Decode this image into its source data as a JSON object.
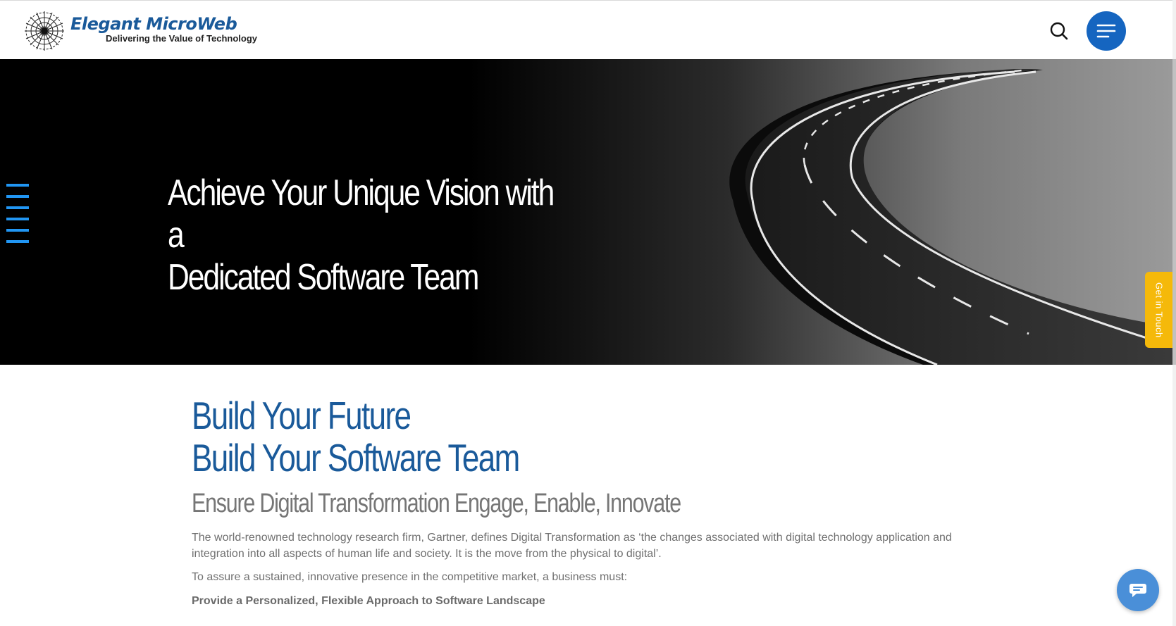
{
  "header": {
    "brand_name": "Elegant MicroWeb",
    "tagline": "Delivering the Value of Technology",
    "search_icon": "search-icon",
    "menu_icon": "hamburger-icon",
    "accent_color": "#1565c0"
  },
  "hero": {
    "title_line1": "Achieve Your Unique Vision with a",
    "title_line2": "Dedicated Software Team",
    "get_in_touch": "Get in Touch",
    "side_menu_icon": "side-menu-icon",
    "tab_color": "#f5b90a"
  },
  "main": {
    "headline_line1": "Build Your Future",
    "headline_line2": "Build Your Software Team",
    "subheading": "Ensure Digital Transformation Engage, Enable, Innovate",
    "paragraph1": "The world-renowned technology research firm, Gartner, defines Digital Transformation as ‘the changes associated with digital technology application and integration into all aspects of human life and society. It is the move from the physical to digital’.",
    "paragraph2": "To assure a sustained, innovative presence in the competitive market, a business must:",
    "bold_line": "Provide a Personalized, Flexible Approach to Software Landscape",
    "headline_color": "#1a5a9a"
  },
  "chat": {
    "icon": "chat-icon"
  }
}
